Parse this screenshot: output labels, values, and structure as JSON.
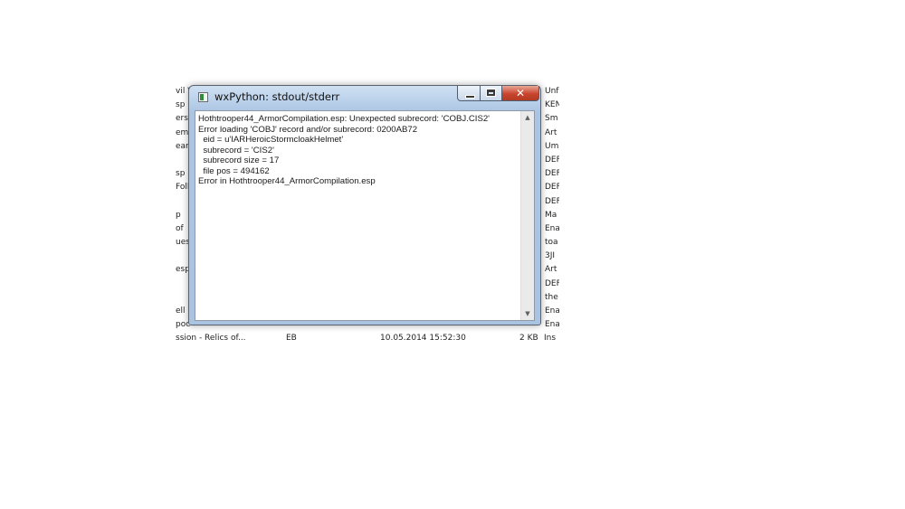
{
  "background_list": {
    "left_col": [
      "vil V",
      "sp",
      "ers",
      "emi",
      "ear",
      "",
      "sp",
      "Follc",
      "",
      "p",
      "of",
      "ues",
      "",
      "esp",
      "",
      "",
      "ell",
      "poca"
    ],
    "right_col": [
      "Unf",
      "KEN",
      "Sm",
      "Art",
      "Um",
      "DEF",
      "DEF",
      "DEF",
      "DEF",
      "Ma",
      "Ena",
      "toa",
      "3JI",
      "Art",
      "DEF",
      "the",
      "Ena",
      "Ena"
    ],
    "bottom_row": {
      "name": "ssion - Relics of...",
      "flag": "EB",
      "date": "10.05.2014 15:52:30",
      "size": "2 KB",
      "desc": "Ins"
    }
  },
  "window": {
    "title": "wxPython: stdout/stderr",
    "close_glyph": "✕",
    "output_lines": [
      "Hothtrooper44_ArmorCompilation.esp: Unexpected subrecord: 'COBJ.CIS2'",
      "Error loading 'COBJ' record and/or subrecord: 0200AB72",
      "  eid = u'IARHeroicStormcloakHelmet'",
      "  subrecord = 'CIS2'",
      "  subrecord size = 17",
      "  file pos = 494162",
      "Error in Hothtrooper44_ArmorCompilation.esp"
    ],
    "scroll_up_glyph": "▲",
    "scroll_down_glyph": "▼"
  }
}
